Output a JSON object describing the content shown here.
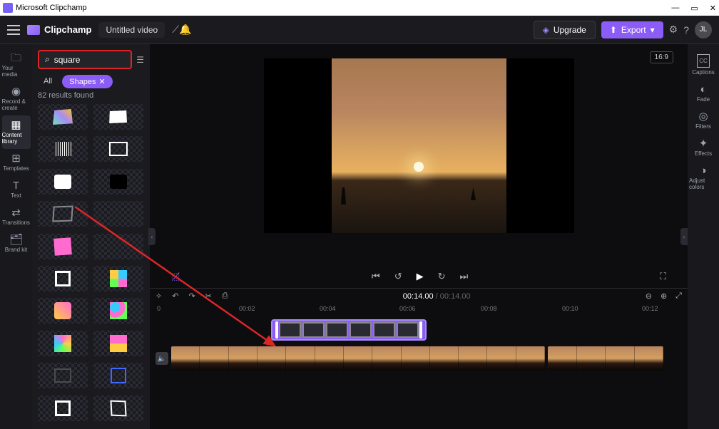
{
  "titlebar": {
    "app": "Microsoft Clipchamp"
  },
  "topbar": {
    "brand": "Clipchamp",
    "project": "Untitled video",
    "upgrade": "Upgrade",
    "export": "Export",
    "avatar": "JL"
  },
  "left_rail": [
    {
      "label": "Your media",
      "icon": "🗀"
    },
    {
      "label": "Record & create",
      "icon": "◉"
    },
    {
      "label": "Content library",
      "icon": "▦",
      "active": true
    },
    {
      "label": "Templates",
      "icon": "⊞"
    },
    {
      "label": "Text",
      "icon": "T"
    },
    {
      "label": "Transitions",
      "icon": "⇄"
    },
    {
      "label": "Brand kit",
      "icon": "🗂"
    }
  ],
  "library": {
    "search_value": "square",
    "chips": {
      "all": "All",
      "shapes": "Shapes"
    },
    "results": "82 results found"
  },
  "preview": {
    "aspect": "16:9"
  },
  "timeline": {
    "current": "00:14.00",
    "total": "00:14.00",
    "marks": [
      "0",
      "00:02",
      "00:04",
      "00:06",
      "00:08",
      "00:10",
      "00:12"
    ]
  },
  "right_rail": [
    {
      "label": "Captions",
      "icon": "CC"
    },
    {
      "label": "Fade",
      "icon": "◐"
    },
    {
      "label": "Filters",
      "icon": "◎"
    },
    {
      "label": "Effects",
      "icon": "✦"
    },
    {
      "label": "Adjust colors",
      "icon": "◑"
    }
  ]
}
